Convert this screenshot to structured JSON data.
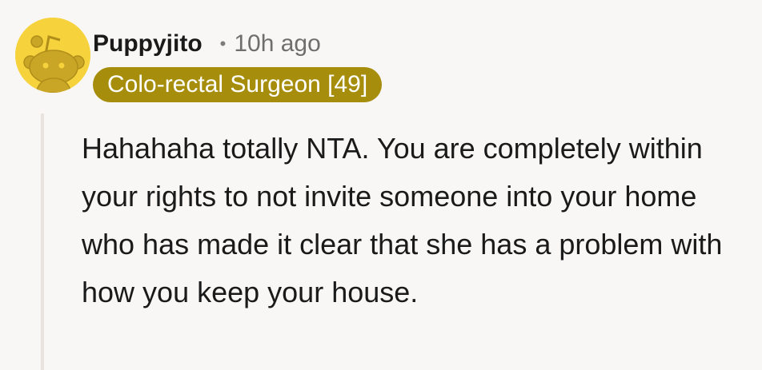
{
  "comment": {
    "username": "Puppyjito",
    "separator": "•",
    "timestamp": "10h ago",
    "flair": "Colo-rectal Surgeon [49]",
    "body": "Hahahaha totally NTA. You are completely within your rights to not invite someone into your home who has made it clear that she has a problem with how you keep your house."
  },
  "colors": {
    "avatar_bg": "#f6d33c",
    "flair_bg": "#a68d0c",
    "flair_text": "#ffffff",
    "page_bg": "#f8f7f5"
  },
  "icons": {
    "avatar": "snoo-avatar-icon"
  }
}
